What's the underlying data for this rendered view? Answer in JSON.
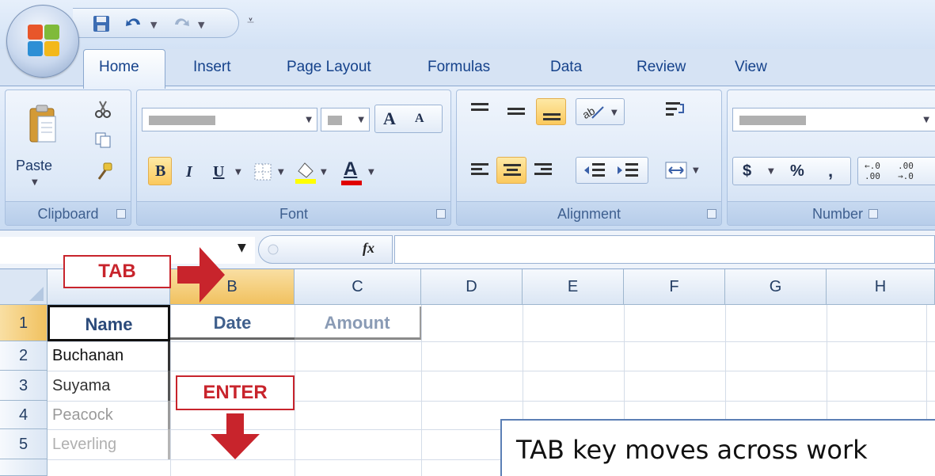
{
  "ribbon_tabs": [
    "Home",
    "Insert",
    "Page Layout",
    "Formulas",
    "Data",
    "Review",
    "View"
  ],
  "active_tab": "Home",
  "groups": {
    "clipboard": {
      "label": "Clipboard",
      "paste_label": "Paste"
    },
    "font": {
      "label": "Font",
      "bold": "B",
      "italic": "I",
      "underline": "U",
      "grow": "A",
      "shrink": "A",
      "font_color": "A"
    },
    "alignment": {
      "label": "Alignment"
    },
    "number": {
      "label": "Number",
      "currency": "$",
      "percent": "%",
      "comma": ",",
      "inc_decimal": "←.0\n.00",
      "dec_decimal": ".00\n→.0"
    }
  },
  "formula_bar": {
    "fx_label": "fx",
    "formula": ""
  },
  "sheet": {
    "columns": [
      "B",
      "C",
      "D",
      "E",
      "F",
      "G",
      "H"
    ],
    "rows": [
      "1",
      "2",
      "3",
      "4",
      "5"
    ],
    "cells": {
      "A1": "Name",
      "B1": "Date",
      "C1": "Amount",
      "A2": "Buchanan",
      "A3": "Suyama",
      "A4": "Peacock",
      "A5": "Leverling"
    }
  },
  "annotations": {
    "tab_label": "TAB",
    "enter_label": "ENTER",
    "tip": "TAB key moves across work"
  },
  "colors": {
    "ribbon_text": "#15428b",
    "callout_red": "#c8242c",
    "selection_orange": "#f1c15f",
    "header_text": "#2b4a7a",
    "faded_text": "#9a9a9a"
  }
}
